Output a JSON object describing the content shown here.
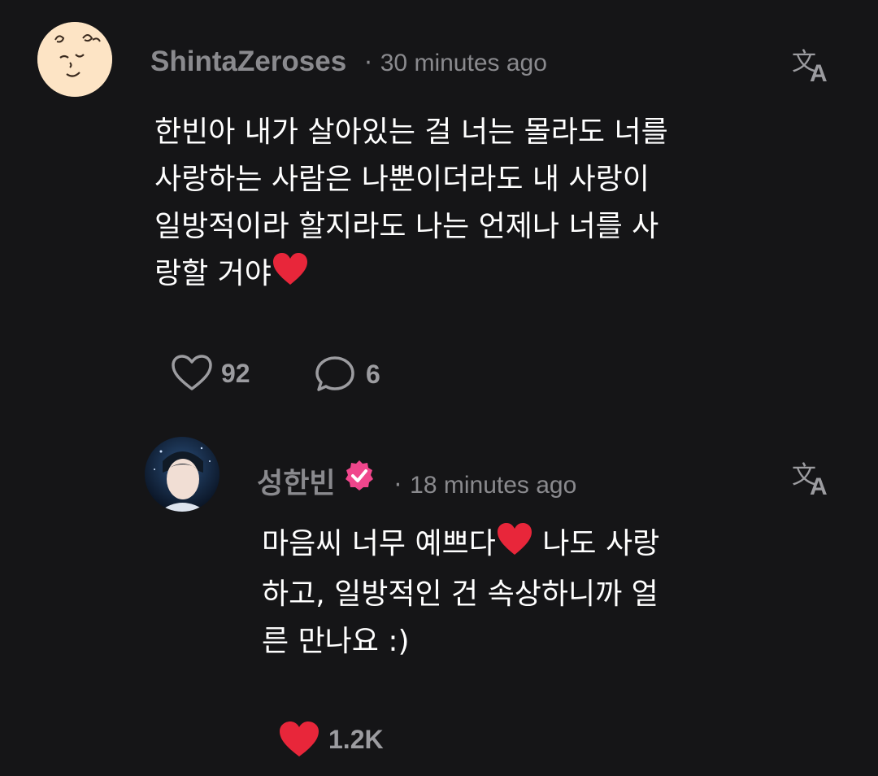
{
  "comment": {
    "username": "ShintaZeroses",
    "separator": "·",
    "time": "30 minutes ago",
    "lines": [
      "한빈아 내가 살아있는 걸 너는 몰라도 너를",
      "사랑하는 사람은 나뿐이더라도 내 사랑이",
      "일방적이라 할지라도 나는 언제나 너를 사",
      "랑할 거야"
    ],
    "like_count": "92",
    "reply_count": "6",
    "translate_icon": "translate-icon",
    "avatar_icon": "smiling-face-avatar"
  },
  "reply": {
    "username": "성한빈",
    "separator": "·",
    "time": "18 minutes ago",
    "lines": [
      "마음씨 너무 예쁘다",
      " 나도 사랑",
      "하고, 일방적인 건 속상하니까 얼",
      "른 만나요 :)"
    ],
    "like_count": "1.2K",
    "verified_icon": "verified-badge-icon",
    "translate_icon": "translate-icon"
  },
  "colors": {
    "background": "#151517",
    "muted": "#8a8a8e",
    "heart": "#e8263a",
    "verified": "#f0468c"
  }
}
